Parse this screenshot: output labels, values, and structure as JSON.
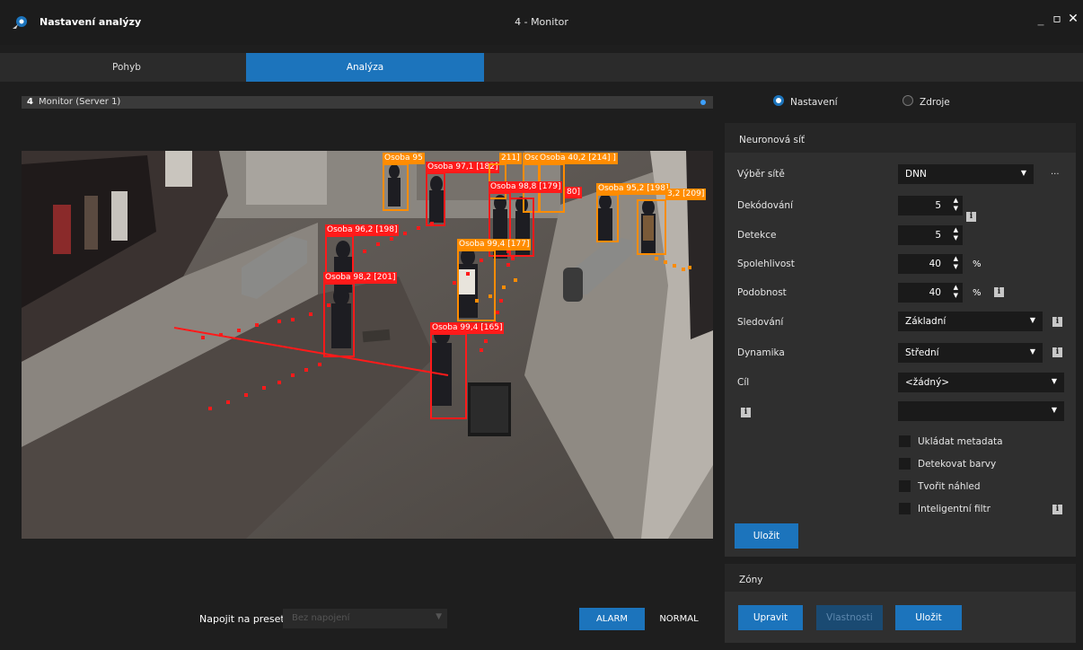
{
  "window": {
    "app_title": "Nastavení analýzy",
    "title": "4 - Monitor",
    "controls": [
      "_",
      "▫",
      "✕"
    ]
  },
  "tabs": [
    {
      "label": "Pohyb",
      "active": false
    },
    {
      "label": "Analýza",
      "active": true
    }
  ],
  "monitor": {
    "number": "4",
    "label": "Monitor (Server 1)"
  },
  "detections": [
    {
      "label": "Osoba 95",
      "color": "orange"
    },
    {
      "label": "Osoba 97,1 [182]",
      "color": "red"
    },
    {
      "label": "211]",
      "color": "orange"
    },
    {
      "label": "Osc",
      "color": "orange"
    },
    {
      "label": "Osoba 40,2 [214] ]",
      "color": "orange"
    },
    {
      "label": "Osoba 98,8 [179]",
      "color": "red"
    },
    {
      "label": "80]",
      "color": "red"
    },
    {
      "label": "Osoba 95,2 [198]",
      "color": "orange"
    },
    {
      "label": "3,2 [209]",
      "color": "orange"
    },
    {
      "label": "Osoba 96,2 [198]",
      "color": "red"
    },
    {
      "label": "Osoba 99,4 [177]",
      "color": "orange"
    },
    {
      "label": "Osoba 98,2 [201]",
      "color": "red"
    },
    {
      "label": "Osoba 99,4 [165]",
      "color": "red"
    }
  ],
  "bottom": {
    "preset_label": "Napojit na preset",
    "preset_value": "Bez napojení",
    "alarm_label": "ALARM",
    "normal_label": "NORMAL"
  },
  "source_radios": [
    {
      "label": "Nastavení",
      "selected": true
    },
    {
      "label": "Zdroje",
      "selected": false
    }
  ],
  "neural_net": {
    "title": "Neuronová síť",
    "network": {
      "label": "Výběr sítě",
      "value": "DNN",
      "more": "..."
    },
    "decoding": {
      "label": "Dekódování",
      "value": "5"
    },
    "detection": {
      "label": "Detekce",
      "value": "5"
    },
    "reliability": {
      "label": "Spolehlivost",
      "value": "40",
      "unit": "%"
    },
    "similarity": {
      "label": "Podobnost",
      "value": "40",
      "unit": "%"
    },
    "tracking": {
      "label": "Sledování",
      "value": "Základní"
    },
    "dynamics": {
      "label": "Dynamika",
      "value": "Střední"
    },
    "target": {
      "label": "Cíl",
      "value": "<žádný>"
    },
    "extra": {
      "value": ""
    },
    "checkboxes": [
      {
        "label": "Ukládat metadata",
        "checked": false
      },
      {
        "label": "Detekovat barvy",
        "checked": false
      },
      {
        "label": "Tvořit náhled",
        "checked": false
      },
      {
        "label": "Inteligentní filtr",
        "checked": false
      }
    ],
    "save_label": "Uložit"
  },
  "zones": {
    "title": "Zóny",
    "edit_label": "Upravit",
    "props_label": "Vlastnosti",
    "save_label": "Uložit"
  },
  "colors": {
    "accent": "#1c74bc",
    "detection_red": "#ff1a1a",
    "detection_orange": "#ff8c00"
  }
}
